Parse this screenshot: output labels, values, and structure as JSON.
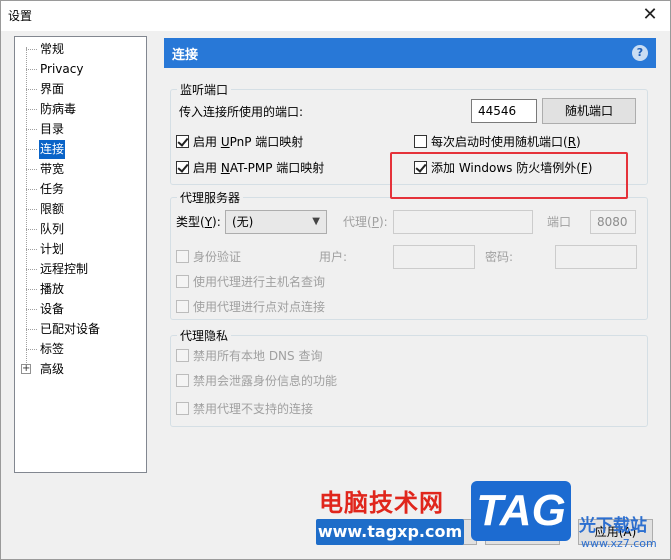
{
  "window": {
    "title": "设置",
    "close_glyph": "✕"
  },
  "sidebar": {
    "items": [
      {
        "label": "常规"
      },
      {
        "label": "Privacy"
      },
      {
        "label": "界面"
      },
      {
        "label": "防病毒"
      },
      {
        "label": "目录"
      },
      {
        "label": "连接",
        "selected": true
      },
      {
        "label": "带宽"
      },
      {
        "label": "任务"
      },
      {
        "label": "限额"
      },
      {
        "label": "队列"
      },
      {
        "label": "计划"
      },
      {
        "label": "远程控制"
      },
      {
        "label": "播放"
      },
      {
        "label": "设备"
      },
      {
        "label": "已配对设备"
      },
      {
        "label": "标签"
      },
      {
        "label": "高级",
        "expander": "+"
      }
    ]
  },
  "panel": {
    "title": "连接",
    "help_glyph": "?",
    "listen_group": {
      "legend": "监听端口",
      "port_label": "传入连接所使用的端口:",
      "port_value": "44546",
      "random_port_button": "随机端口",
      "upnp_prefix": "启用 ",
      "upnp_key": "U",
      "upnp_suffix": "PnP 端口映射",
      "upnp_checked": true,
      "random_each_start_prefix": "每次启动时使用随机端口(",
      "random_each_start_key": "R",
      "random_each_start_suffix": ")",
      "random_each_start_checked": false,
      "natpmp_prefix": "启用 ",
      "natpmp_key": "N",
      "natpmp_suffix": "AT-PMP 端口映射",
      "natpmp_checked": true,
      "firewall_prefix": "添加 Windows 防火墙例外(",
      "firewall_key": "F",
      "firewall_suffix": ")",
      "firewall_checked": true
    },
    "proxy_group": {
      "legend": "代理服务器",
      "type_prefix": "类型(",
      "type_key": "Y",
      "type_suffix": "):",
      "type_value": "(无)",
      "proxy_prefix": "代理(",
      "proxy_key": "P",
      "proxy_suffix": "):",
      "proxy_value": "",
      "port_label": "端口",
      "port_value": "8080",
      "auth_label": "身份验证",
      "user_label": "用户:",
      "user_value": "",
      "password_label": "密码:",
      "password_value": "",
      "hostname_lookup_label": "使用代理进行主机名查询",
      "p2p_label": "使用代理进行点对点连接"
    },
    "privacy_group": {
      "legend": "代理隐私",
      "disable_dns_label": "禁用所有本地 DNS 查询",
      "disable_identity_label": "禁用会泄露身份信息的功能",
      "disable_unsupported_label": "禁用代理不支持的连接"
    }
  },
  "dialog_buttons": {
    "ok": "确定",
    "cancel": "取消",
    "apply": "应用(A)"
  },
  "watermark": {
    "cn_text": "电脑技术网",
    "url": "www.tagxp.com",
    "tag": "TAG",
    "site_cn": "光下载站",
    "site_url": "www.xz7.com"
  },
  "colors": {
    "accent": "#2878d7",
    "selection": "#0a64c8",
    "highlight_box": "#e5323a"
  }
}
